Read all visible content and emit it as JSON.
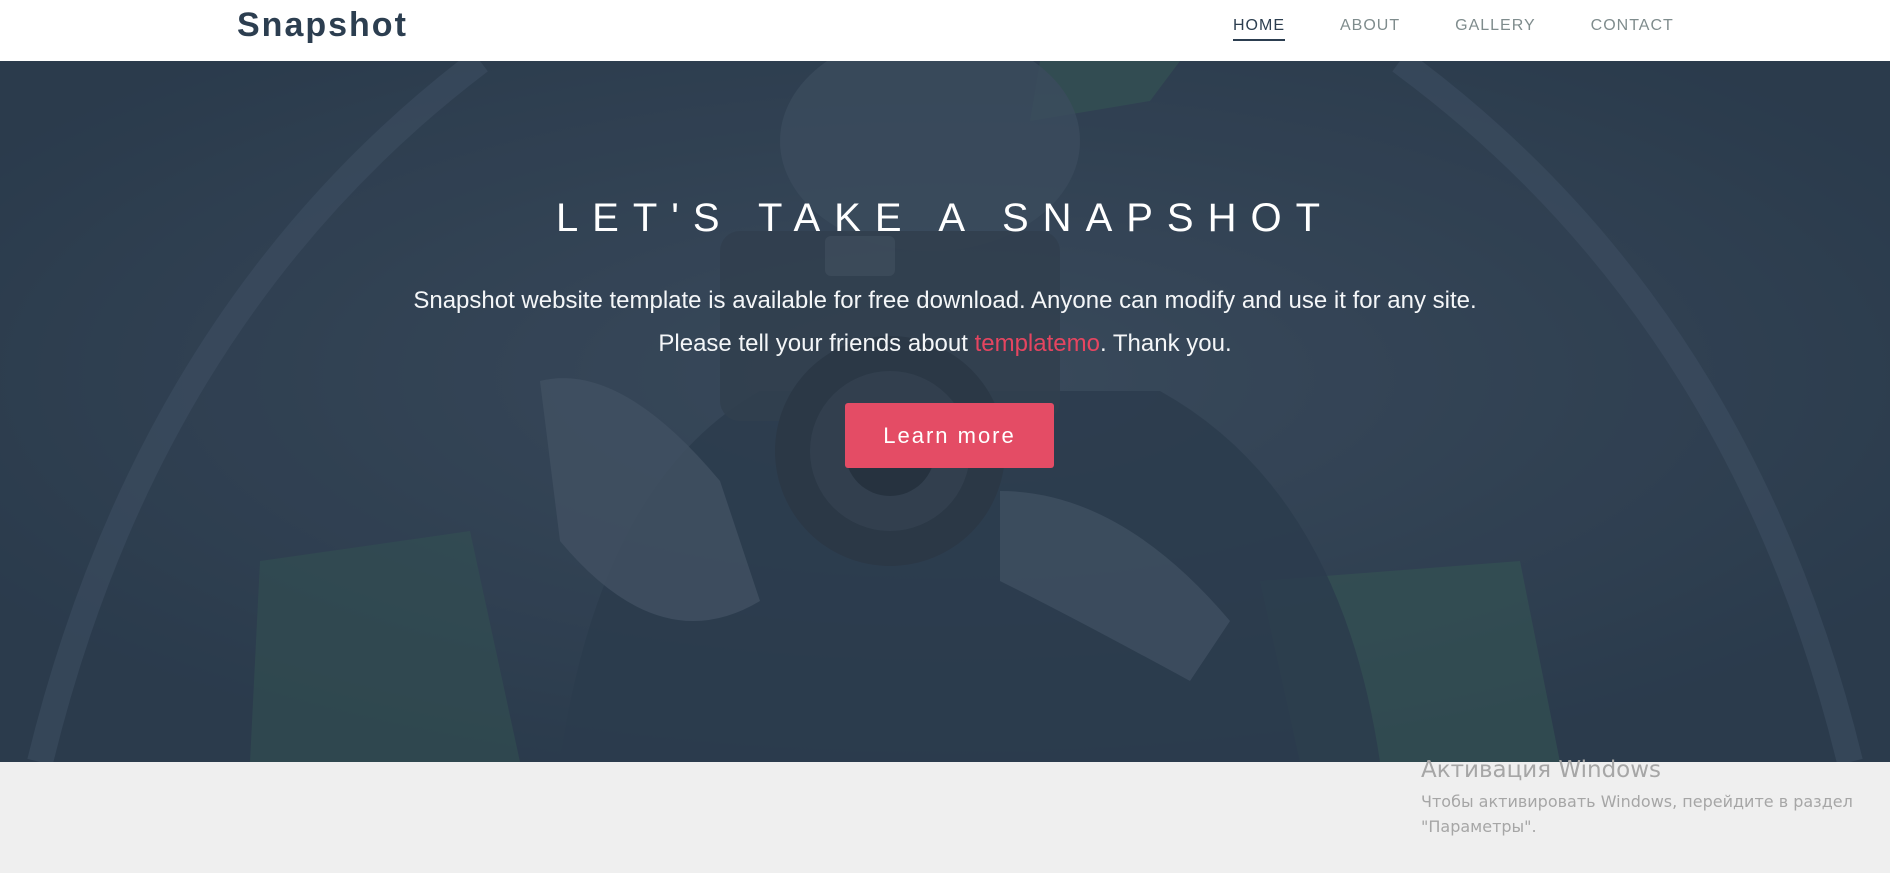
{
  "brand": "Snapshot",
  "nav": {
    "items": [
      {
        "label": "HOME",
        "active": true
      },
      {
        "label": "ABOUT",
        "active": false
      },
      {
        "label": "GALLERY",
        "active": false
      },
      {
        "label": "CONTACT",
        "active": false
      }
    ]
  },
  "hero": {
    "title": "LET'S TAKE A SNAPSHOT",
    "line1": "Snapshot website template is available for free download. Anyone can modify and use it for any site.",
    "line2_prefix": "Please tell your friends about ",
    "line2_link": "templatemo",
    "line2_suffix": ". Thank you.",
    "button": "Learn more"
  },
  "watermark": {
    "title": "Активация Windows",
    "line1": "Чтобы активировать Windows, перейдите в раздел",
    "line2": "\"Параметры\"."
  },
  "colors": {
    "brand_text": "#2c3e50",
    "accent": "#e44c65",
    "hero_overlay": "#2c3e50",
    "footer_bg": "#efefef"
  },
  "icons": [
    "camera-photo-background"
  ]
}
